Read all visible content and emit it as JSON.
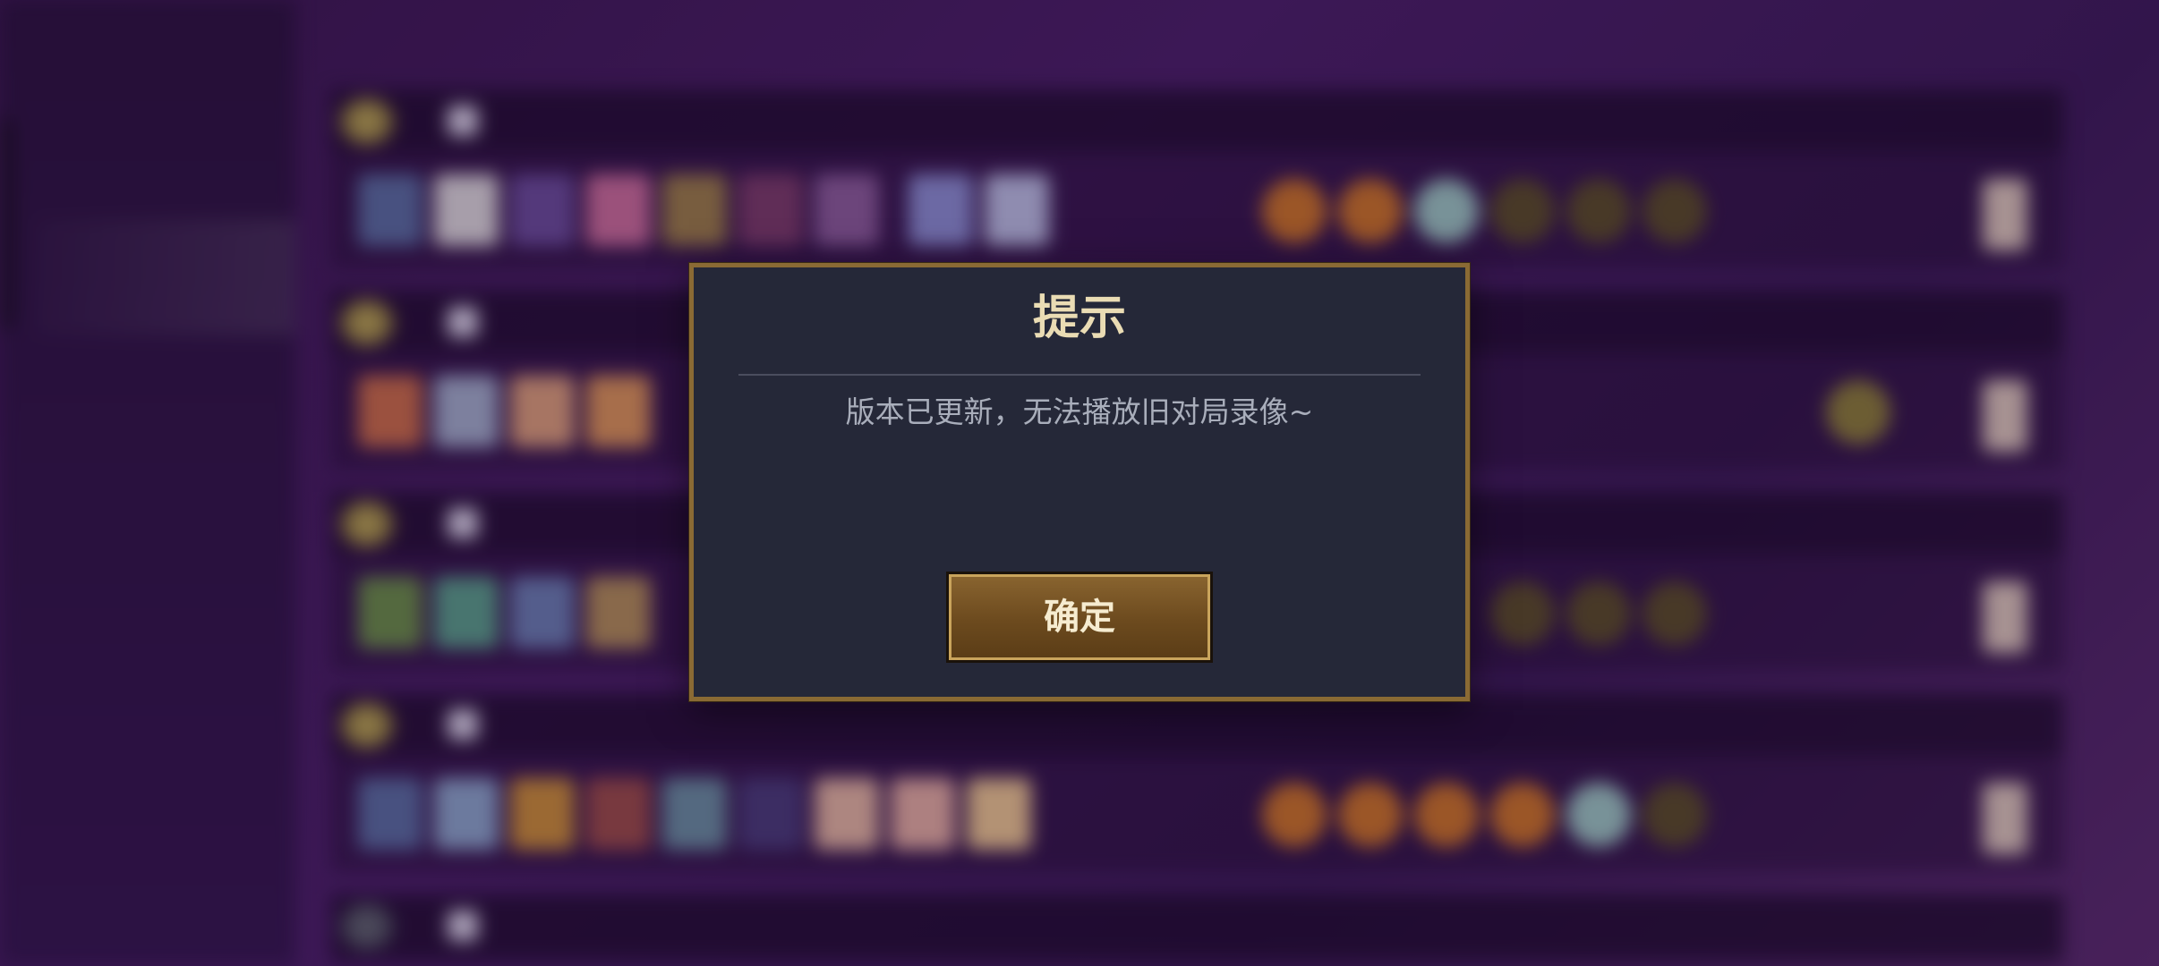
{
  "dialog": {
    "title": "提示",
    "message": "版本已更新，无法播放旧对局录像~",
    "confirm_label": "确定"
  },
  "colors": {
    "background_purple": "#4a1e68",
    "dialog_bg": "#252838",
    "dialog_border_gold": "#8a6a34",
    "title_gold": "#eadcb4",
    "button_brown": "#6c4a1e"
  }
}
